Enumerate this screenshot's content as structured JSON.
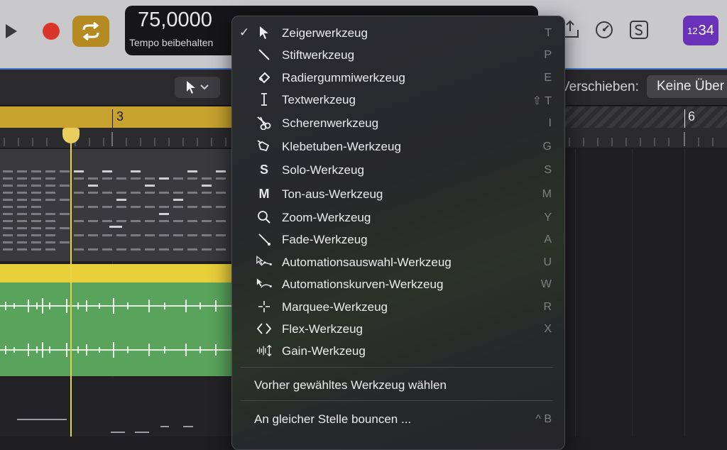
{
  "lcd": {
    "tempo_value": "75,0000",
    "tempo_label": "Tempo beibehalten"
  },
  "status_badge": {
    "small": "12",
    "big": "34"
  },
  "toolbar2": {
    "nudge_label": "Verschieben:",
    "nudge_value": "Keine Über"
  },
  "ruler": {
    "bar3": "3",
    "bar6": "6"
  },
  "menu": {
    "tools": [
      {
        "icon": "pointer-icon",
        "label": "Zeigerwerkzeug",
        "key": "T",
        "checked": true
      },
      {
        "icon": "pencil-icon",
        "label": "Stiftwerkzeug",
        "key": "P"
      },
      {
        "icon": "eraser-icon",
        "label": "Radiergummiwerkzeug",
        "key": "E"
      },
      {
        "icon": "text-cursor-icon",
        "label": "Textwerkzeug",
        "key": "⇧ T"
      },
      {
        "icon": "scissors-icon",
        "label": "Scherenwerkzeug",
        "key": "I"
      },
      {
        "icon": "glue-icon",
        "label": "Klebetuben-Werkzeug",
        "key": "G"
      },
      {
        "icon": "solo-icon",
        "label": "Solo-Werkzeug",
        "key": "S"
      },
      {
        "icon": "mute-icon",
        "label": "Ton-aus-Werkzeug",
        "key": "M"
      },
      {
        "icon": "zoom-icon",
        "label": "Zoom-Werkzeug",
        "key": "Y"
      },
      {
        "icon": "fade-icon",
        "label": "Fade-Werkzeug",
        "key": "A"
      },
      {
        "icon": "automation-select-icon",
        "label": "Automationsauswahl-Werkzeug",
        "key": "U"
      },
      {
        "icon": "automation-curve-icon",
        "label": "Automationskurven-Werkzeug",
        "key": "W"
      },
      {
        "icon": "marquee-icon",
        "label": "Marquee-Werkzeug",
        "key": "R"
      },
      {
        "icon": "flex-icon",
        "label": "Flex-Werkzeug",
        "key": "X"
      },
      {
        "icon": "gain-icon",
        "label": "Gain-Werkzeug",
        "key": ""
      }
    ],
    "previous_tool": "Vorher gewähltes Werkzeug wählen",
    "bounce_in_place": "An gleicher Stelle bouncen ...",
    "bounce_key": "^ B"
  }
}
